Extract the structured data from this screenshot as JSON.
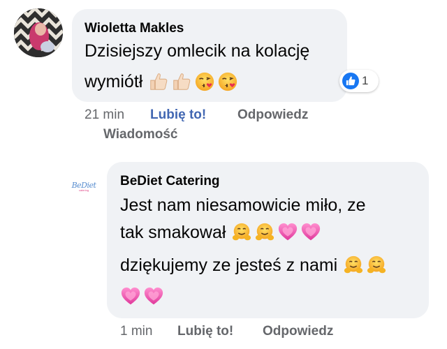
{
  "comments": [
    {
      "author": "Wioletta Makles",
      "text_line1": "Dzisiejszy omlecik na kolację",
      "text_line2": "wymiótł",
      "emojis_line2": [
        "thumbs-up-light-icon",
        "thumbs-up-light-icon",
        "kissing-face-heart-icon",
        "kissing-face-heart-icon"
      ],
      "reaction": {
        "icon": "like-icon",
        "count": "1"
      },
      "time": "21 min",
      "like_label": "Lubię to!",
      "reply_label": "Odpowiedz",
      "message_label": "Wiadomość"
    },
    {
      "author": "BeDiet Catering",
      "avatar_logo": "BeDiet",
      "avatar_logo_sub": "catering",
      "text_line1": "Jest nam niesamowicie miło, ze",
      "text_line2": "tak smakował",
      "emojis_line2": [
        "hugging-face-icon",
        "hugging-face-icon",
        "pink-heart-icon",
        "pink-heart-icon"
      ],
      "text_line3": "dziękujemy ze jesteś z nami",
      "emojis_line3": [
        "hugging-face-icon",
        "hugging-face-icon"
      ],
      "emojis_line4": [
        "pink-heart-icon",
        "pink-heart-icon"
      ],
      "time": "1 min",
      "like_label": "Lubię to!",
      "reply_label": "Odpowiedz"
    }
  ],
  "colors": {
    "bubble": "#f0f2f5",
    "like_blue": "#4267b2",
    "meta_gray": "#65676b"
  }
}
